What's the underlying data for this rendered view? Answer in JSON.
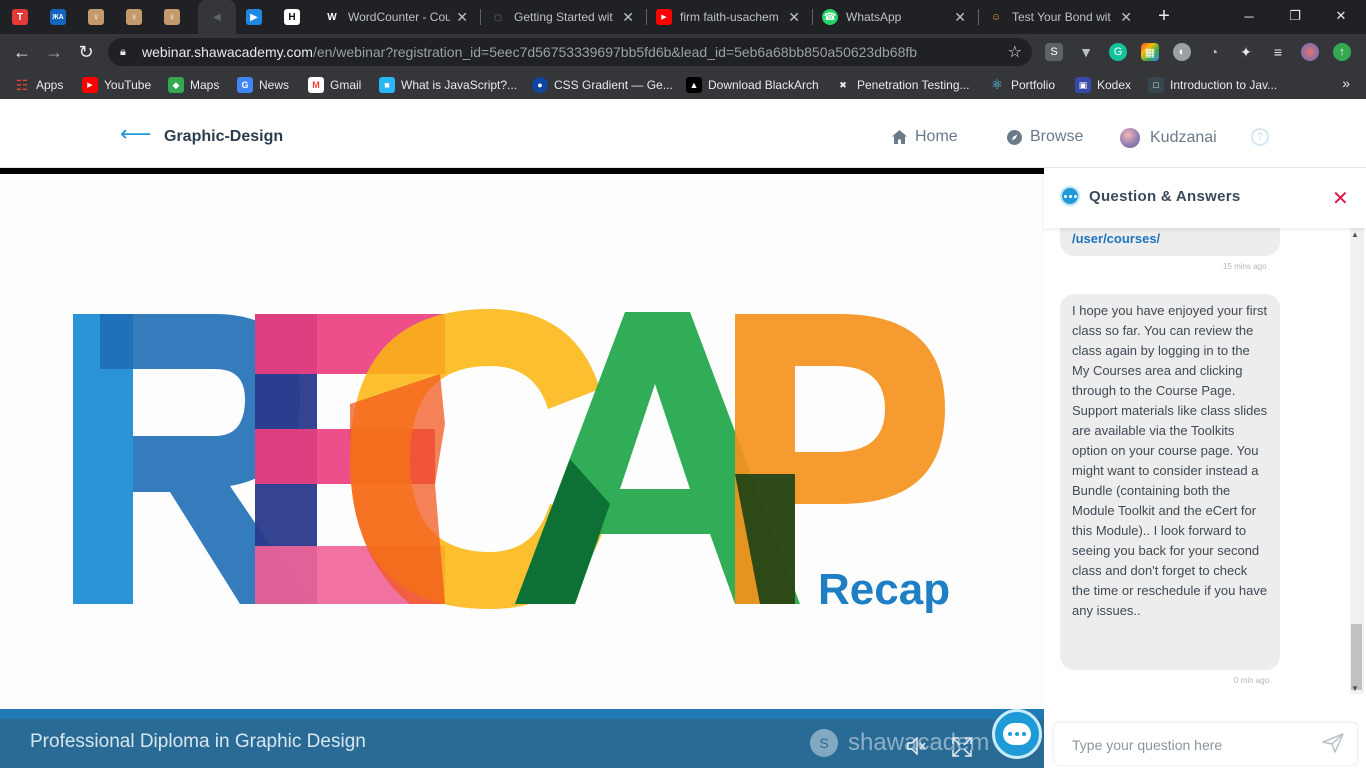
{
  "browser": {
    "tabs": [
      {
        "favicon": "T",
        "color": "#e53935",
        "title": ""
      },
      {
        "favicon": "ЖА",
        "color": "#1565c0",
        "title": ""
      },
      {
        "favicon": "♀",
        "color": "#c49a6c",
        "title": ""
      },
      {
        "favicon": "♀",
        "color": "#c49a6c",
        "title": ""
      },
      {
        "favicon": "♀",
        "color": "#c49a6c",
        "title": ""
      },
      {
        "favicon": "◀",
        "color": "#5f6368",
        "title": ""
      },
      {
        "favicon": "▶",
        "color": "#1e88e5",
        "title": ""
      },
      {
        "favicon": "H",
        "color": "#111111",
        "title": ""
      },
      {
        "favicon": "W",
        "color": "#202124",
        "title": "WordCounter - Cou"
      },
      {
        "favicon": "◌",
        "color": "#5f6368",
        "title": "Getting Started wit"
      },
      {
        "favicon": "▶",
        "color": "#ff0000",
        "title": "firm faith-usachem"
      },
      {
        "favicon": "☎",
        "color": "#25d366",
        "title": "WhatsApp"
      },
      {
        "favicon": "☺",
        "color": "#4285f4",
        "title": "Test Your Bond wit"
      }
    ],
    "url_host": "webinar.shawacademy.com",
    "url_path": "/en/webinar?registration_id=5eec7d56753339697bb5fd6b&lead_id=5eb6a68bb850a50623db68fb",
    "bookmarks": [
      {
        "label": "Apps",
        "icon_color": "#ea4335",
        "glyph": "☷"
      },
      {
        "label": "YouTube",
        "icon_color": "#ff0000",
        "glyph": "▶"
      },
      {
        "label": "Maps",
        "icon_color": "#34a853",
        "glyph": "◆"
      },
      {
        "label": "News",
        "icon_color": "#4285f4",
        "glyph": "G"
      },
      {
        "label": "Gmail",
        "icon_color": "#ea4335",
        "glyph": "M"
      },
      {
        "label": "What is JavaScript?...",
        "icon_color": "#29b6f6",
        "glyph": "■"
      },
      {
        "label": "CSS Gradient — Ge...",
        "icon_color": "#0d47a1",
        "glyph": "●"
      },
      {
        "label": "Download BlackArch",
        "icon_color": "#000000",
        "glyph": "▲"
      },
      {
        "label": "Penetration Testing...",
        "icon_color": "#222222",
        "glyph": "✖"
      },
      {
        "label": "Portfolio",
        "icon_color": "#1e88e5",
        "glyph": "⚛"
      },
      {
        "label": "Kodex",
        "icon_color": "#3949ab",
        "glyph": "▣"
      },
      {
        "label": "Introduction to Jav...",
        "icon_color": "#37474f",
        "glyph": "□"
      }
    ]
  },
  "header": {
    "course": "Graphic-Design",
    "nav": {
      "home": "Home",
      "browse": "Browse",
      "user": "Kudzanai"
    },
    "help": "?"
  },
  "stage": {
    "recap_letters": "RECAP",
    "recap_word": "Recap",
    "footer_title": "Professional Diploma in Graphic Design",
    "brand": "shawacadem",
    "brand_badge": "S"
  },
  "qa": {
    "title": "Question & Answers",
    "messages": [
      {
        "text": "/user/courses/",
        "time": "15 mins ago",
        "link": true
      },
      {
        "text": "I hope you have enjoyed your first class so far. You can review the class again by logging in to the My Courses area and clicking through to the Course Page. Support materials like class slides are available via the Toolkits option on your course page. You might want to consider instead a Bundle (containing both the Module Toolkit and the eCert for this Module).. I look forward to seeing you back for your second class and don't forget to check the time or reschedule if you have any issues..",
        "time": "0 min ago",
        "link": false
      }
    ],
    "input_placeholder": "Type your question here"
  },
  "colors": {
    "accent": "#1e9bd7",
    "close": "#e2134b",
    "footer_bar": "#2a6b95"
  }
}
